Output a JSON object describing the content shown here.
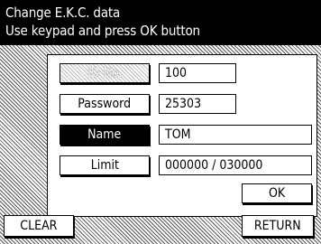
{
  "header": {
    "title": "Change E.K.C. data",
    "instruction": "Use keypad and press OK button"
  },
  "fields": {
    "id_label": "ID No.",
    "id_value": "100",
    "password_label": "Password",
    "password_value": "25303",
    "name_label": "Name",
    "name_value": "TOM",
    "limit_label": "Limit",
    "limit_value": "000000 / 030000"
  },
  "buttons": {
    "ok_label": "OK",
    "clear_label": "CLEAR",
    "return_label": "RETURN"
  }
}
